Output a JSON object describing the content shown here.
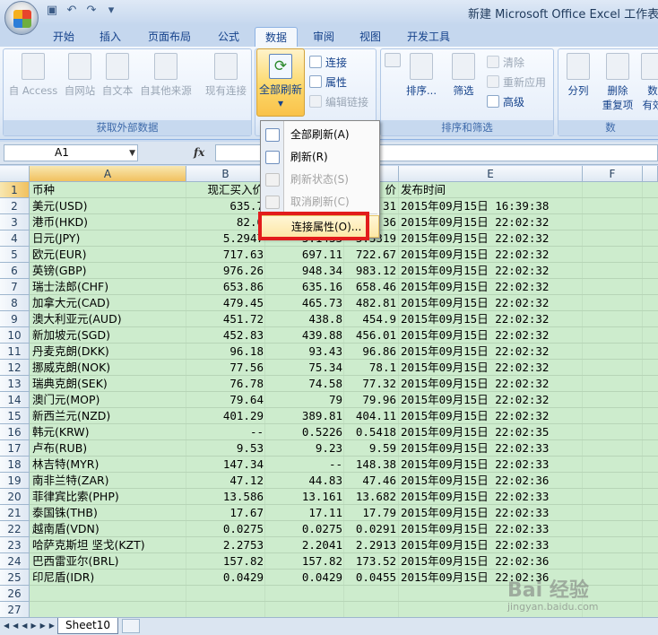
{
  "window": {
    "title": "新建 Microsoft Office Excel 工作表.xls"
  },
  "tabs": [
    "开始",
    "插入",
    "页面布局",
    "公式",
    "数据",
    "审阅",
    "视图",
    "开发工具"
  ],
  "active_tab": "数据",
  "ribbon": {
    "external_group_label": "获取外部数据",
    "sort_group_label": "排序和筛选",
    "tools_group_label": "数",
    "access": "自 Access",
    "web": "自网站",
    "text": "自文本",
    "other": "自其他来源",
    "existing": "现有连接",
    "refresh_all": "全部刷新",
    "refresh_arrow": "▾",
    "connections": "连接",
    "properties": "属性",
    "edit_links": "编辑链接",
    "sort": "排序...",
    "filter": "筛选",
    "clear": "清除",
    "reapply": "重新应用",
    "advanced": "高级",
    "split": "分列",
    "remove_dup_1": "删除",
    "remove_dup_2": "重复项",
    "validation_1": "数",
    "validation_2": "有效"
  },
  "formula_bar": {
    "cell_ref": "A1",
    "fx": "fx"
  },
  "menu": {
    "items": [
      {
        "label": "全部刷新(A)",
        "enabled": true
      },
      {
        "label": "刷新(R)",
        "enabled": true
      },
      {
        "label": "刷新状态(S)",
        "enabled": false
      },
      {
        "label": "取消刷新(C)",
        "enabled": false
      },
      {
        "label": "连接属性(O)...",
        "enabled": true
      }
    ]
  },
  "columns": [
    "A",
    "B",
    "C",
    "D",
    "E",
    "F"
  ],
  "rows": [
    {
      "n": "1",
      "a": "币种",
      "b": "现汇买入价",
      "c": "",
      "d": "价",
      "e": "发布时间"
    },
    {
      "n": "2",
      "a": "美元(USD)",
      "b": "635.7",
      "c": "",
      "d": "31",
      "e": "2015年09月15日 16:39:38"
    },
    {
      "n": "3",
      "a": "港币(HKD)",
      "b": "82.0",
      "c": "",
      "d": "36",
      "e": "2015年09月15日 22:02:32"
    },
    {
      "n": "4",
      "a": "日元(JPY)",
      "b": "5.2947",
      "c": "5.1433",
      "d": "5.3319",
      "e": "2015年09月15日 22:02:32"
    },
    {
      "n": "5",
      "a": "欧元(EUR)",
      "b": "717.63",
      "c": "697.11",
      "d": "722.67",
      "e": "2015年09月15日 22:02:32"
    },
    {
      "n": "6",
      "a": "英镑(GBP)",
      "b": "976.26",
      "c": "948.34",
      "d": "983.12",
      "e": "2015年09月15日 22:02:32"
    },
    {
      "n": "7",
      "a": "瑞士法郎(CHF)",
      "b": "653.86",
      "c": "635.16",
      "d": "658.46",
      "e": "2015年09月15日 22:02:32"
    },
    {
      "n": "8",
      "a": "加拿大元(CAD)",
      "b": "479.45",
      "c": "465.73",
      "d": "482.81",
      "e": "2015年09月15日 22:02:32"
    },
    {
      "n": "9",
      "a": "澳大利亚元(AUD)",
      "b": "451.72",
      "c": "438.8",
      "d": "454.9",
      "e": "2015年09月15日 22:02:32"
    },
    {
      "n": "10",
      "a": "新加坡元(SGD)",
      "b": "452.83",
      "c": "439.88",
      "d": "456.01",
      "e": "2015年09月15日 22:02:32"
    },
    {
      "n": "11",
      "a": "丹麦克朗(DKK)",
      "b": "96.18",
      "c": "93.43",
      "d": "96.86",
      "e": "2015年09月15日 22:02:32"
    },
    {
      "n": "12",
      "a": "挪威克朗(NOK)",
      "b": "77.56",
      "c": "75.34",
      "d": "78.1",
      "e": "2015年09月15日 22:02:32"
    },
    {
      "n": "13",
      "a": "瑞典克朗(SEK)",
      "b": "76.78",
      "c": "74.58",
      "d": "77.32",
      "e": "2015年09月15日 22:02:32"
    },
    {
      "n": "14",
      "a": "澳门元(MOP)",
      "b": "79.64",
      "c": "79",
      "d": "79.96",
      "e": "2015年09月15日 22:02:32"
    },
    {
      "n": "15",
      "a": "新西兰元(NZD)",
      "b": "401.29",
      "c": "389.81",
      "d": "404.11",
      "e": "2015年09月15日 22:02:32"
    },
    {
      "n": "16",
      "a": "韩元(KRW)",
      "b": "--",
      "c": "0.5226",
      "d": "0.5418",
      "e": "2015年09月15日 22:02:35"
    },
    {
      "n": "17",
      "a": "卢布(RUB)",
      "b": "9.53",
      "c": "9.23",
      "d": "9.59",
      "e": "2015年09月15日 22:02:33"
    },
    {
      "n": "18",
      "a": "林吉特(MYR)",
      "b": "147.34",
      "c": "--",
      "d": "148.38",
      "e": "2015年09月15日 22:02:33"
    },
    {
      "n": "19",
      "a": "南非兰特(ZAR)",
      "b": "47.12",
      "c": "44.83",
      "d": "47.46",
      "e": "2015年09月15日 22:02:36"
    },
    {
      "n": "20",
      "a": "菲律宾比索(PHP)",
      "b": "13.586",
      "c": "13.161",
      "d": "13.682",
      "e": "2015年09月15日 22:02:33"
    },
    {
      "n": "21",
      "a": "泰国铢(THB)",
      "b": "17.67",
      "c": "17.11",
      "d": "17.79",
      "e": "2015年09月15日 22:02:33"
    },
    {
      "n": "22",
      "a": "越南盾(VDN)",
      "b": "0.0275",
      "c": "0.0275",
      "d": "0.0291",
      "e": "2015年09月15日 22:02:33"
    },
    {
      "n": "23",
      "a": "哈萨克斯坦 坚戈(KZT)",
      "b": "2.2753",
      "c": "2.2041",
      "d": "2.2913",
      "e": "2015年09月15日 22:02:33"
    },
    {
      "n": "24",
      "a": "巴西雷亚尔(BRL)",
      "b": "157.82",
      "c": "157.82",
      "d": "173.52",
      "e": "2015年09月15日 22:02:36"
    },
    {
      "n": "25",
      "a": "印尼盾(IDR)",
      "b": "0.0429",
      "c": "0.0429",
      "d": "0.0455",
      "e": "2015年09月15日 22:02:36"
    },
    {
      "n": "26",
      "a": "",
      "b": "",
      "c": "",
      "d": "",
      "e": ""
    },
    {
      "n": "27",
      "a": "",
      "b": "",
      "c": "",
      "d": "",
      "e": ""
    }
  ],
  "sheet": {
    "tab": "Sheet10"
  },
  "watermark": {
    "main": "Bai 经验",
    "sub": "jingyan.baidu.com"
  },
  "colors": {
    "highlight_box": "#e21c1c",
    "selected_header": "#f1c15f",
    "cell_fill": "#cdeccd"
  }
}
